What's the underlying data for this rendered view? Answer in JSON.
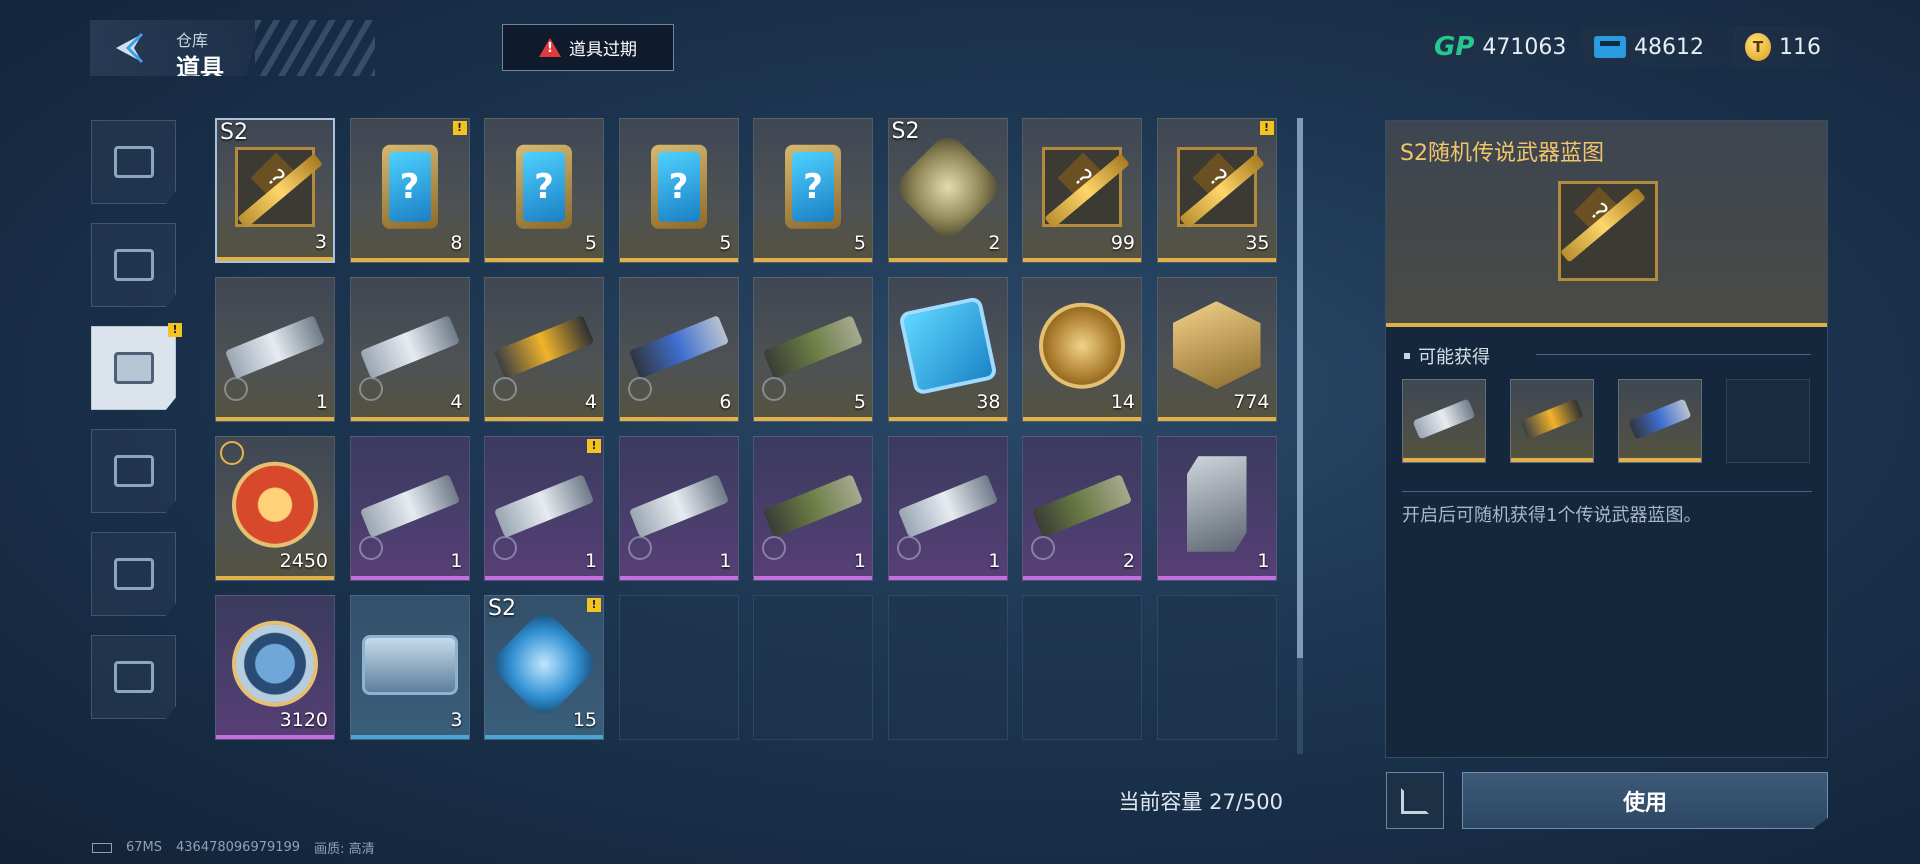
{
  "header": {
    "back_sub": "仓库",
    "back_title": "道具",
    "expire_label": "道具过期",
    "currencies": [
      {
        "icon": "gp-icon",
        "label": "GP",
        "value": "471063"
      },
      {
        "icon": "ticket-icon",
        "value": "48612"
      },
      {
        "icon": "gold-coin-icon",
        "glyph": "T",
        "value": "116"
      }
    ]
  },
  "categories": [
    {
      "name": "weapons",
      "icon": "pistol-icon"
    },
    {
      "name": "cards",
      "icon": "card-icon"
    },
    {
      "name": "items",
      "icon": "tag-icon",
      "selected": true,
      "badge": "!"
    },
    {
      "name": "attachments",
      "icon": "gun-part-icon"
    },
    {
      "name": "blueprints",
      "icon": "blueprint-icon"
    },
    {
      "name": "badges",
      "icon": "star-icon"
    }
  ],
  "grid": {
    "items": [
      {
        "type": "bp",
        "rarity": "gold",
        "tag": "S2",
        "count": "3",
        "selected": true
      },
      {
        "type": "card",
        "rarity": "gold",
        "count": "8",
        "badge": "!"
      },
      {
        "type": "card",
        "rarity": "gold",
        "count": "5"
      },
      {
        "type": "card",
        "rarity": "gold",
        "count": "5"
      },
      {
        "type": "card",
        "rarity": "gold",
        "count": "5"
      },
      {
        "type": "cube",
        "rarity": "gold",
        "tag": "S2",
        "count": "2"
      },
      {
        "type": "bp",
        "rarity": "gold",
        "count": "99"
      },
      {
        "type": "bp",
        "rarity": "gold",
        "count": "35",
        "badge": "!"
      },
      {
        "type": "gun",
        "rarity": "gold",
        "count": "1",
        "clock": true
      },
      {
        "type": "gun",
        "rarity": "gold",
        "count": "4",
        "clock": true
      },
      {
        "type": "gun yel",
        "rarity": "gold",
        "count": "4",
        "clock": true
      },
      {
        "type": "gun blu",
        "rarity": "gold",
        "count": "6",
        "clock": true
      },
      {
        "type": "gun grn",
        "rarity": "gold",
        "count": "5",
        "clock": true
      },
      {
        "type": "chip",
        "rarity": "gold",
        "count": "38"
      },
      {
        "type": "coin",
        "rarity": "gold",
        "count": "14"
      },
      {
        "type": "hex",
        "rarity": "gold",
        "count": "774"
      },
      {
        "type": "coin red",
        "rarity": "gold",
        "count": "2450",
        "clock_gold": true
      },
      {
        "type": "gun",
        "rarity": "purple",
        "count": "1",
        "clock": true
      },
      {
        "type": "gun",
        "rarity": "purple",
        "count": "1",
        "clock": true,
        "badge": "!"
      },
      {
        "type": "gun",
        "rarity": "purple",
        "count": "1",
        "clock": true
      },
      {
        "type": "gun grn",
        "rarity": "purple",
        "count": "1",
        "clock": true
      },
      {
        "type": "gun",
        "rarity": "purple",
        "count": "1",
        "clock": true
      },
      {
        "type": "gun grn",
        "rarity": "purple",
        "count": "2",
        "clock": true
      },
      {
        "type": "tag2",
        "rarity": "purple",
        "count": "1"
      },
      {
        "type": "coin ring",
        "rarity": "purple",
        "count": "3120"
      },
      {
        "type": "box",
        "rarity": "blue",
        "count": "3"
      },
      {
        "type": "cube blue",
        "rarity": "blue",
        "tag": "S2",
        "count": "15",
        "badge": "!"
      },
      {
        "type": "empty"
      },
      {
        "type": "empty"
      },
      {
        "type": "empty"
      },
      {
        "type": "empty"
      },
      {
        "type": "empty"
      }
    ]
  },
  "capacity": "当前容量 27/500",
  "status": {
    "ping": "67MS",
    "uid": "436478096979199",
    "quality": "画质: 高清"
  },
  "detail": {
    "name": "S2随机传说武器蓝图",
    "possible_label": "可能获得",
    "rewards": [
      "gun",
      "gun yel",
      "gun blu",
      "empty"
    ],
    "description": "开启后可随机获得1个传说武器蓝图。",
    "use_label": "使用"
  },
  "colors": {
    "gold": "#e0b04a",
    "purple": "#c56ee0",
    "blue": "#4aa4d8",
    "accent_title": "#f1c56a",
    "gp": "#29c58f",
    "warning": "#e0393d"
  }
}
